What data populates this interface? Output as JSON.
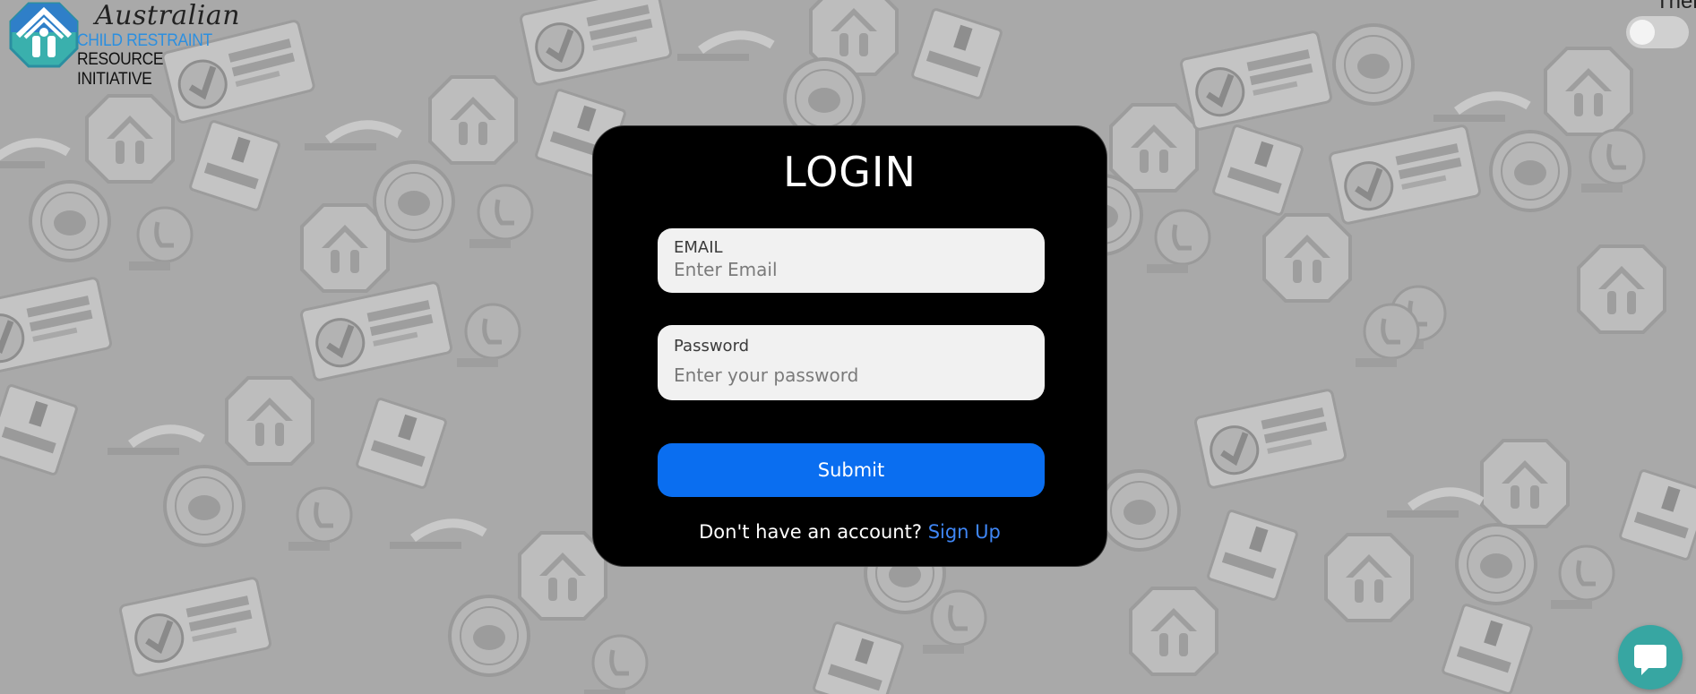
{
  "logo": {
    "line1": "Australian",
    "line2": "CHILD RESTRAINT",
    "line3": "RESOURCE INITIATIVE"
  },
  "theme": {
    "label": "Theme",
    "enabled": false
  },
  "login": {
    "title": "LOGIN",
    "email_label": "EMAIL",
    "email_placeholder": "Enter Email",
    "password_label": "Password",
    "password_placeholder": "Enter your password",
    "submit_label": "Submit",
    "signup_prompt": "Don't have an account?",
    "signup_link": "Sign Up"
  },
  "colors": {
    "background": "#a9a9a9",
    "card": "#000000",
    "accent": "#0a6ef0",
    "link": "#3f86f5",
    "chat": "#37a6a2"
  },
  "icons": [
    "logo-mark-icon",
    "chat-icon",
    "background-badge-icon"
  ]
}
